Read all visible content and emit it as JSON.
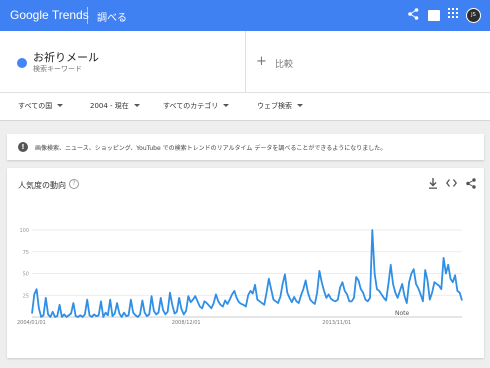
{
  "header": {
    "brand": "Google Trends",
    "page_name": "調べる",
    "avatar_initials": "JS",
    "bar_color": "#3f80f3"
  },
  "search_terms": {
    "term": "お祈りメール",
    "term_type": "検索キーワード",
    "term_color": "#4285f4",
    "compare_label": "比較"
  },
  "filters": {
    "region": "すべての国",
    "time": "2004 - 現在",
    "category": "すべてのカテゴリ",
    "search_type": "ウェブ検索"
  },
  "notice": {
    "icon": "info-icon",
    "text": "画像検索、ニュース、ショッピング、YouTube での検索トレンドのリアルタイム データを調べることができるようになりました。"
  },
  "chart_card": {
    "title": "人気度の動向",
    "icons": [
      "help-icon",
      "download-icon",
      "embed-icon",
      "share-icon"
    ]
  },
  "chart_data": {
    "type": "line",
    "series": [
      {
        "values": [
          4,
          26,
          32,
          10,
          0,
          2,
          22,
          3,
          0,
          6,
          0,
          1,
          14,
          0,
          3,
          0,
          2,
          4,
          16,
          1,
          0,
          2,
          0,
          3,
          20,
          2,
          0,
          3,
          1,
          2,
          18,
          0,
          5,
          2,
          20,
          1,
          4,
          16,
          4,
          0,
          5,
          1,
          2,
          20,
          5,
          2,
          0,
          3,
          19,
          5,
          1,
          3,
          24,
          7,
          3,
          5,
          22,
          8,
          3,
          6,
          28,
          14,
          4,
          6,
          22,
          9,
          3,
          7,
          24,
          17,
          20,
          24,
          18,
          12,
          10,
          18,
          16,
          13,
          10,
          16,
          26,
          18,
          14,
          12,
          19,
          15,
          20,
          26,
          30,
          22,
          17,
          15,
          14,
          12,
          25,
          30,
          27,
          37,
          20,
          18,
          16,
          14,
          28,
          44,
          32,
          20,
          18,
          16,
          23,
          38,
          49,
          28,
          22,
          17,
          23,
          18,
          16,
          25,
          32,
          42,
          28,
          20,
          17,
          15,
          28,
          53,
          40,
          30,
          22,
          26,
          21,
          19,
          18,
          20,
          34,
          40,
          30,
          26,
          18,
          18,
          22,
          46,
          42,
          32,
          28,
          20,
          18,
          22,
          100,
          50,
          32,
          30,
          26,
          22,
          19,
          38,
          60,
          38,
          28,
          22,
          30,
          38,
          24,
          16,
          40,
          50,
          55,
          38,
          33,
          26,
          18,
          54,
          42,
          20,
          28,
          40,
          38,
          36,
          32,
          68,
          50,
          60,
          44,
          40,
          48,
          30,
          28,
          19
        ]
      }
    ],
    "x_tick_labels": [
      "2004/01/01",
      "2008/12/01",
      "2013/11/01"
    ],
    "y_ticks": [
      25,
      50,
      75,
      100
    ],
    "ylim": [
      0,
      100
    ],
    "annotation": "Note",
    "line_color": "#2f8fe6",
    "grid": true
  }
}
